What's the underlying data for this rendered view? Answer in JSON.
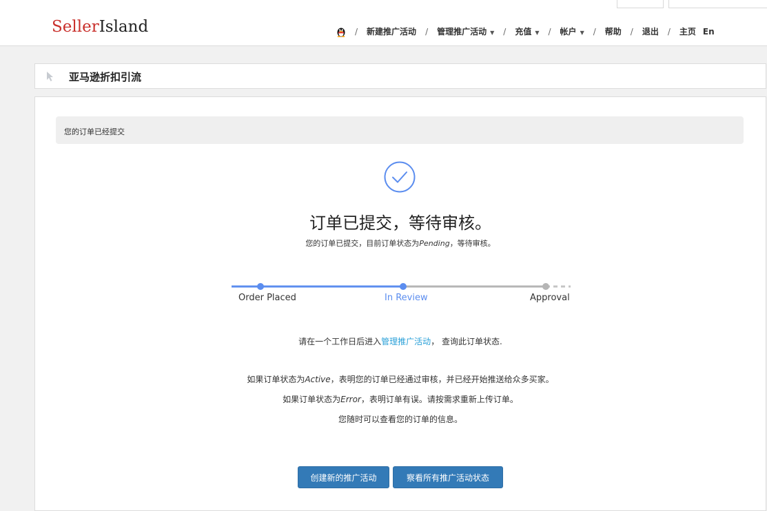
{
  "brand": {
    "part1": "Seller",
    "part2": "Island"
  },
  "nav": {
    "items": [
      {
        "label": "新建推广活动",
        "caret": false
      },
      {
        "label": "管理推广活动",
        "caret": true
      },
      {
        "label": "充值",
        "caret": true
      },
      {
        "label": "帐户",
        "caret": true
      },
      {
        "label": "帮助",
        "caret": false
      },
      {
        "label": "退出",
        "caret": false
      },
      {
        "label": "主页",
        "caret": false
      }
    ],
    "lang": "En",
    "separator": "/"
  },
  "panel": {
    "title": "亚马逊折扣引流"
  },
  "alert": {
    "text": "您的订单已经提交"
  },
  "status": {
    "headline": "订单已提交，等待审核。",
    "sub_prefix": "您的订单已提交，目前订单状态为",
    "sub_status": "Pending",
    "sub_suffix": "，等待审核。"
  },
  "progress": {
    "steps": [
      "Order Placed",
      "In Review",
      "Approval"
    ],
    "active_index": 1,
    "colors": {
      "done": "#5b8def",
      "active_label": "#5b8def",
      "pending": "#b5b5b5"
    }
  },
  "instructions": {
    "line1_prefix": "请在一个工作日后进入",
    "line1_link": "管理推广活动",
    "line1_suffix": "， 查询此订单状态.",
    "line2_prefix": "如果订单状态为",
    "line2_status": "Active",
    "line2_suffix": "，表明您的订单已经通过审核，并已经开始推送给众多买家。",
    "line3_prefix": "如果订单状态为",
    "line3_status": "Error",
    "line3_suffix": "，表明订单有误。请按需求重新上传订单。",
    "line4": "您随时可以查看您的订单的信息。"
  },
  "buttons": {
    "create": "创建新的推广活动",
    "view_all": "察看所有推广活动状态"
  },
  "icons": {
    "qq": "qq-penguin-icon",
    "cursor": "cursor-icon",
    "check": "check-circle-icon"
  },
  "colors": {
    "brand_red": "#c9302c",
    "primary": "#337ab7",
    "link": "#2aa0d8",
    "check": "#5b8def"
  }
}
